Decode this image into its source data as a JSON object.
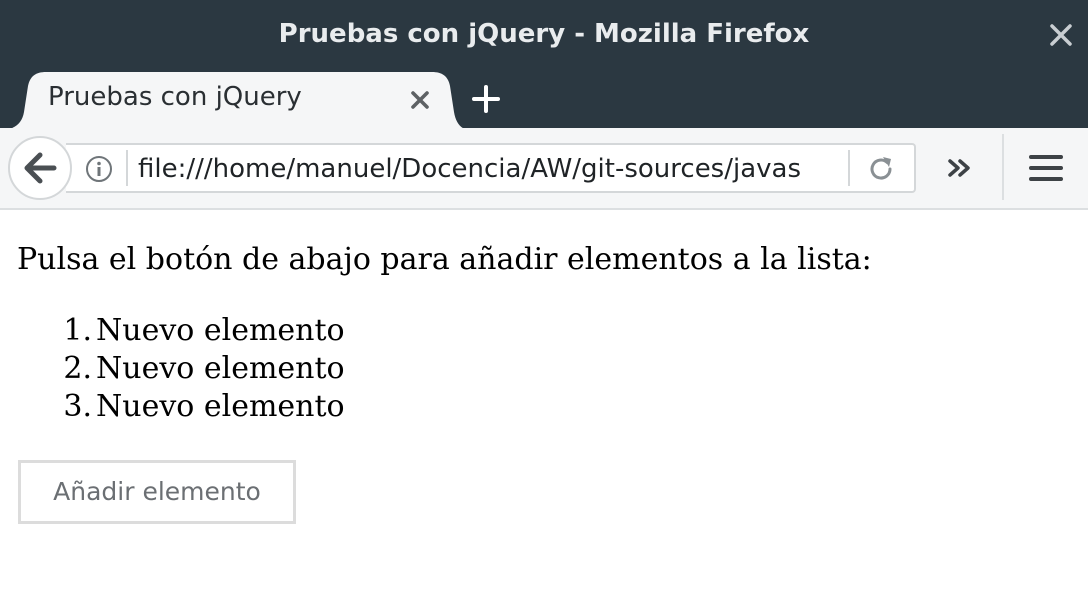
{
  "window": {
    "title": "Pruebas con jQuery - Mozilla Firefox",
    "close_icon": "close-icon"
  },
  "tabs": [
    {
      "label": "Pruebas con jQuery",
      "active": true
    }
  ],
  "toolbar": {
    "url": "file:///home/manuel/Docencia/AW/git-sources/javas",
    "icons": [
      "back-arrow-icon",
      "info-icon",
      "reload-icon",
      "overflow-chevron-icon",
      "hamburger-menu-icon"
    ]
  },
  "page": {
    "intro": "Pulsa el botón de abajo para añadir elementos a la lista:",
    "list": [
      {
        "num": "1.",
        "text": "Nuevo elemento"
      },
      {
        "num": "2.",
        "text": "Nuevo elemento"
      },
      {
        "num": "3.",
        "text": "Nuevo elemento"
      }
    ],
    "button_label": "Añadir elemento"
  },
  "colors": {
    "chrome_dark": "#2b3841",
    "toolbar_bg": "#f5f6f7",
    "tab_bg": "#f5f6f7",
    "button_border": "#dcdcdc"
  }
}
